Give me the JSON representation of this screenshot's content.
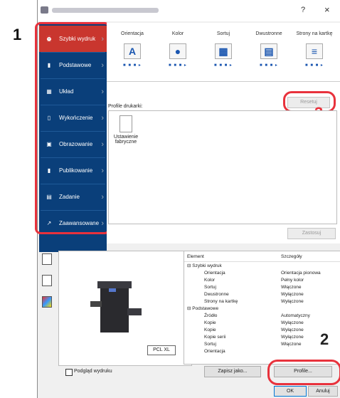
{
  "window": {
    "help": "?",
    "close": "×"
  },
  "sidebar": {
    "items": [
      {
        "label": "Szybki wydruk",
        "icon": "clock-icon"
      },
      {
        "label": "Podstawowe",
        "icon": "page-icon"
      },
      {
        "label": "Układ",
        "icon": "layout-icon"
      },
      {
        "label": "Wykończenie",
        "icon": "finishing-icon"
      },
      {
        "label": "Obrazowanie",
        "icon": "image-icon"
      },
      {
        "label": "Publikowanie",
        "icon": "publish-icon"
      },
      {
        "label": "Zadanie",
        "icon": "job-icon"
      },
      {
        "label": "Zaawansowane",
        "icon": "advanced-icon"
      }
    ]
  },
  "tabs": [
    {
      "label": "Orientacja",
      "glyph": "A"
    },
    {
      "label": "Kolor",
      "glyph": "●"
    },
    {
      "label": "Sortuj",
      "glyph": "▦"
    },
    {
      "label": "Dwustronne",
      "glyph": "▤"
    },
    {
      "label": "Strony na kartkę",
      "glyph": "≡"
    }
  ],
  "reset_label": "Resetuj",
  "profiles": {
    "title": "Profile drukarki:",
    "item_line1": "Ustawienie",
    "item_line2": "fabryczne"
  },
  "apply_label": "Zastosuj",
  "pcl_label": "PCL XL",
  "details": {
    "col_element": "Element",
    "col_details": "Szczegóły",
    "rows": [
      {
        "k": "⊟ Szybki wydruk",
        "v": "",
        "indent": false
      },
      {
        "k": "Orientacja",
        "v": "Orientacja pionowa",
        "indent": true
      },
      {
        "k": "Kolor",
        "v": "Pełny kolor",
        "indent": true
      },
      {
        "k": "Sortuj",
        "v": "Włączone",
        "indent": true
      },
      {
        "k": "Dwustronne",
        "v": "Wyłączone",
        "indent": true
      },
      {
        "k": "Strony na kartkę",
        "v": "Wyłączone",
        "indent": true
      },
      {
        "k": "⊟ Podstawowe",
        "v": "",
        "indent": false
      },
      {
        "k": "Źródło",
        "v": "Automatyczny",
        "indent": true
      },
      {
        "k": "Kopie",
        "v": "Wyłączone",
        "indent": true
      },
      {
        "k": "Kopie",
        "v": "Wyłączone",
        "indent": true
      },
      {
        "k": "Kopie serii",
        "v": "Wyłączone",
        "indent": true
      },
      {
        "k": "Sortuj",
        "v": "Włączone",
        "indent": true
      },
      {
        "k": "Orientacja",
        "v": "",
        "indent": true
      }
    ]
  },
  "preview_label": "Podgląd wydruku",
  "save_as_label": "Zapisz jako...",
  "profile_btn_label": "Profile...",
  "ok_label": "OK",
  "cancel_label": "Anuluj",
  "callouts": {
    "one": "1",
    "two": "2",
    "three": "3"
  },
  "colors": {
    "sidebar": "#0a3f7a",
    "active": "#c9362e",
    "highlight": "#e8323c"
  }
}
